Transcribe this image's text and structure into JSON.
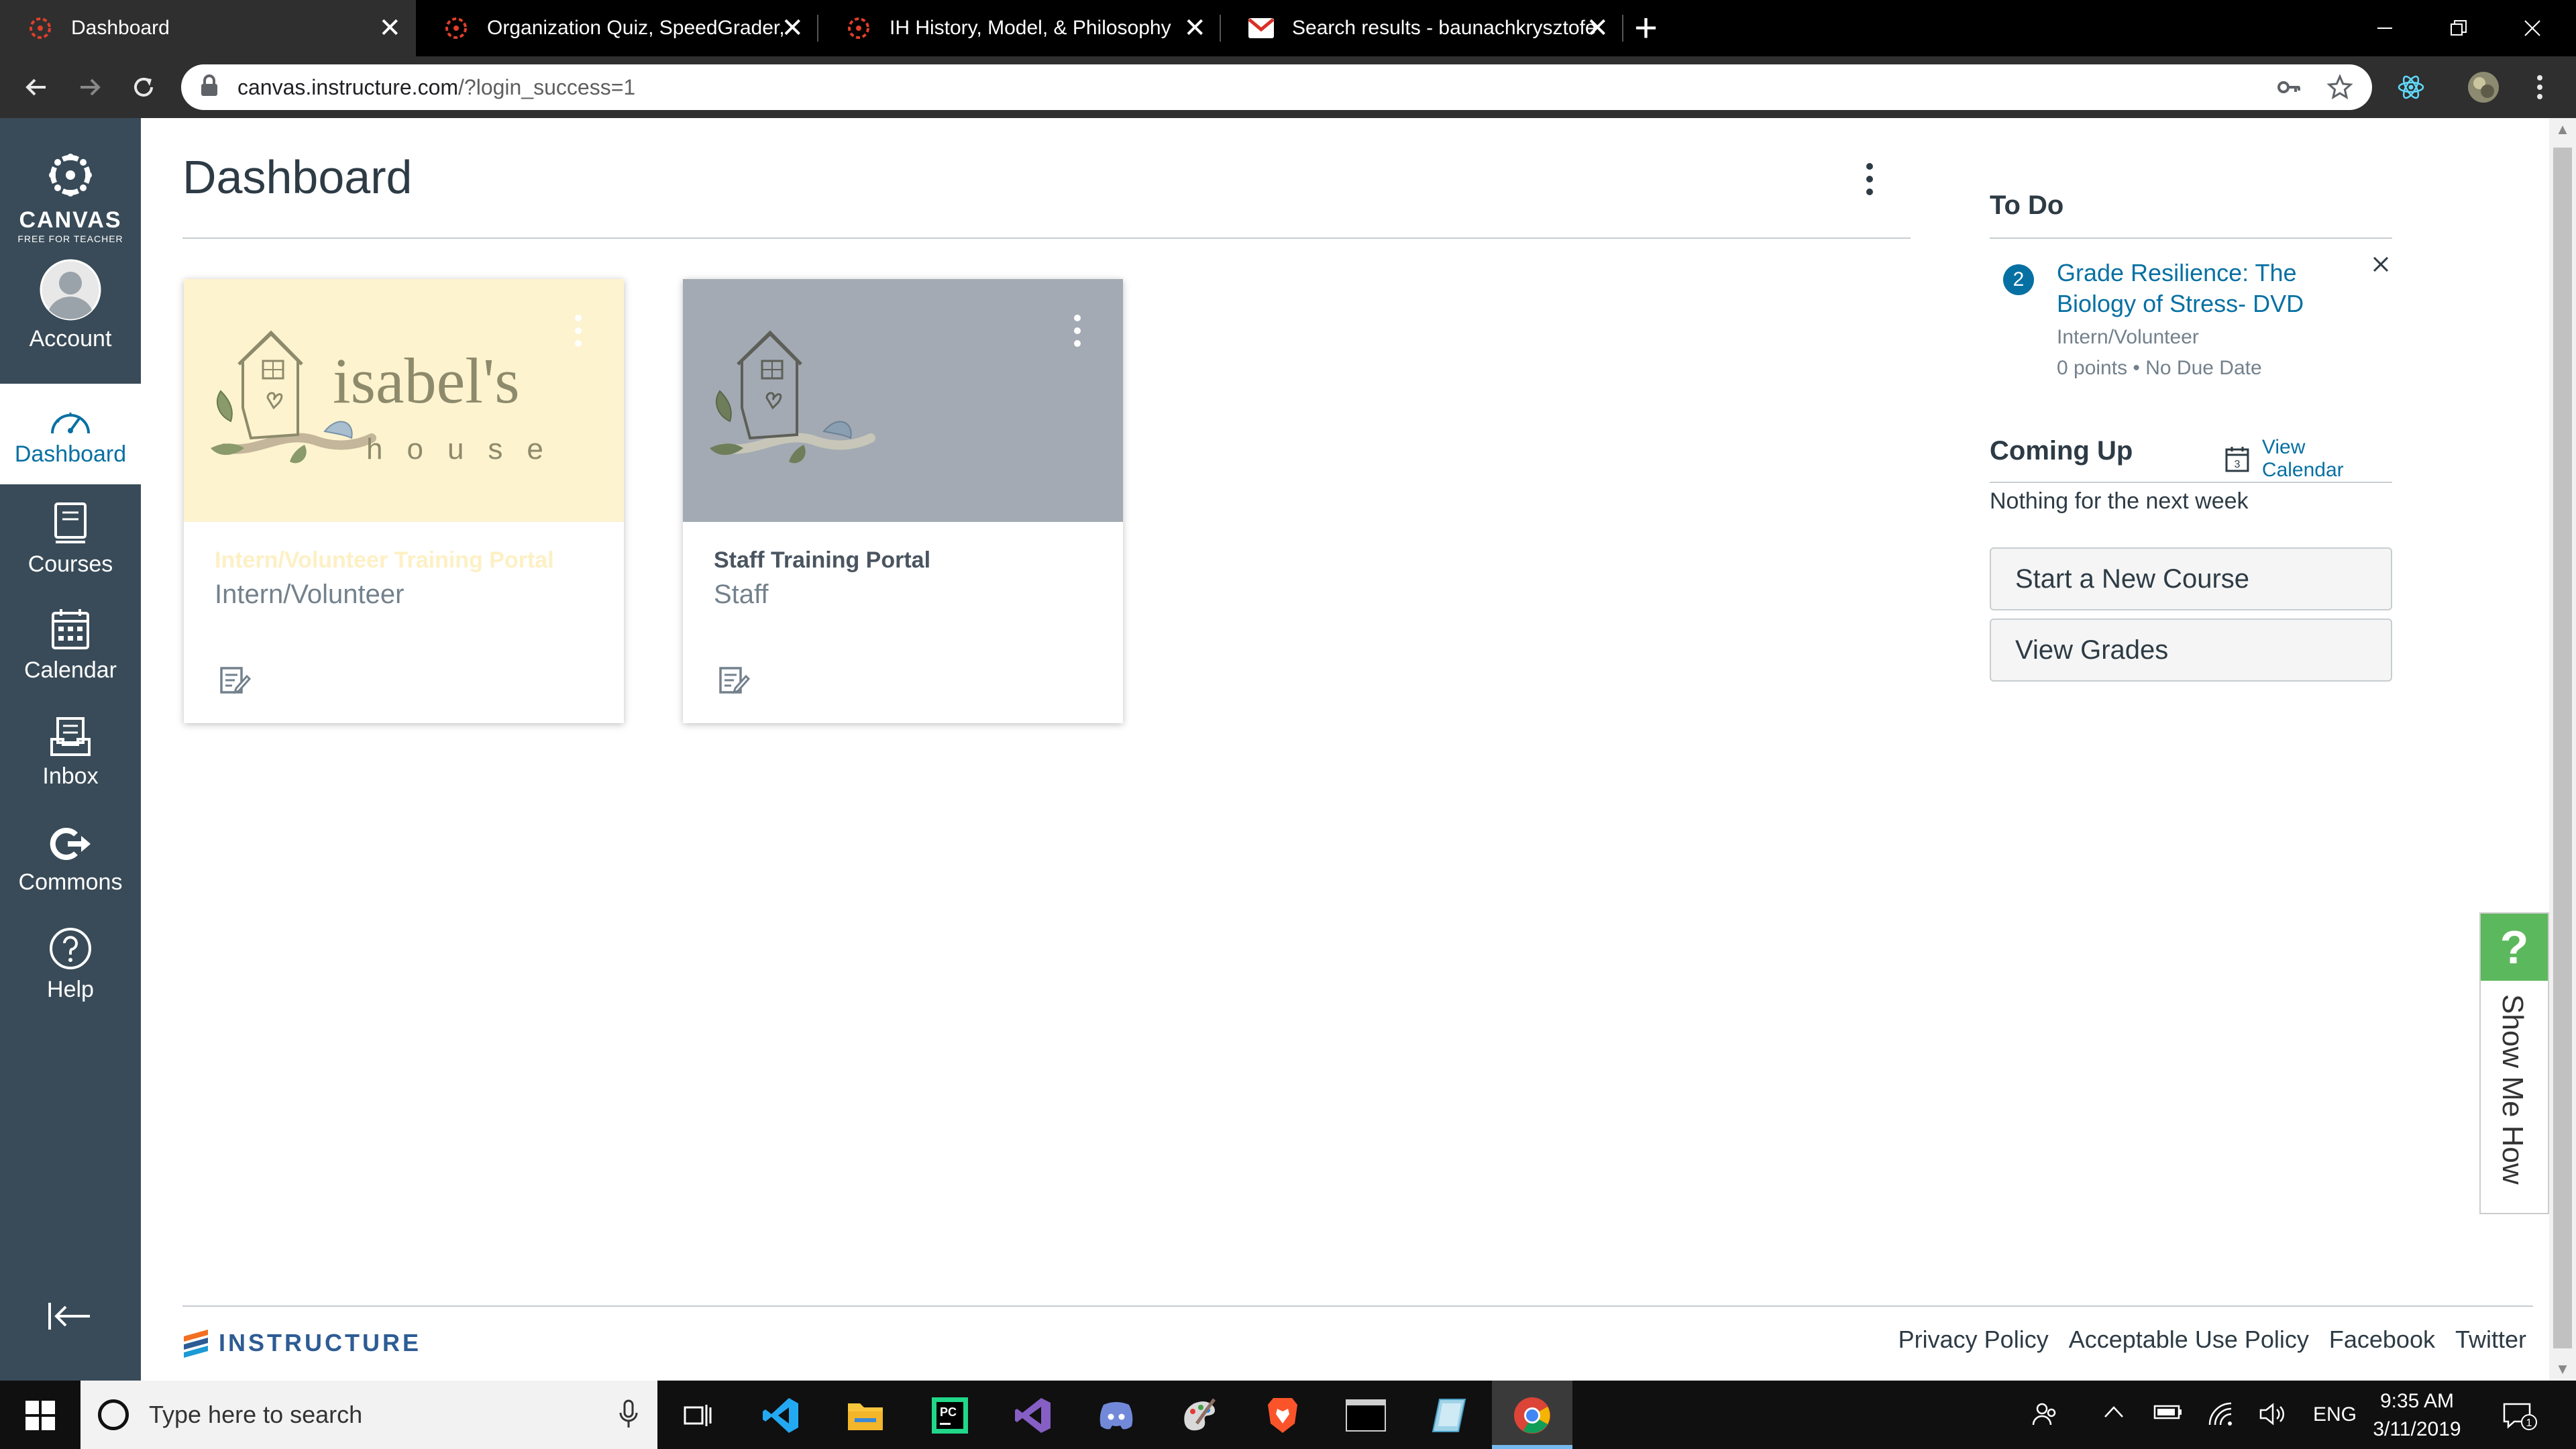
{
  "browser": {
    "tabs": [
      {
        "title": "Dashboard",
        "active": true,
        "icon": "canvas-icon"
      },
      {
        "title": "Organization Quiz, SpeedGrader,",
        "active": false,
        "icon": "canvas-icon"
      },
      {
        "title": "IH History, Model, & Philosophy",
        "active": false,
        "icon": "canvas-icon"
      },
      {
        "title": "Search results - baunachkrysztofe",
        "active": false,
        "icon": "gmail-icon"
      }
    ],
    "close_glyph": "✕",
    "new_tab_glyph": "+",
    "url_host": "canvas.instructure.com",
    "url_path": "/?login_success=1"
  },
  "sidebar": {
    "logo_text": "CANVAS",
    "logo_sub": "FREE FOR TEACHER",
    "items": [
      {
        "label": "Account",
        "icon": "avatar-icon",
        "active": false
      },
      {
        "label": "Dashboard",
        "icon": "dashboard-icon",
        "active": true
      },
      {
        "label": "Courses",
        "icon": "courses-icon",
        "active": false
      },
      {
        "label": "Calendar",
        "icon": "calendar-icon",
        "active": false
      },
      {
        "label": "Inbox",
        "icon": "inbox-icon",
        "active": false
      },
      {
        "label": "Commons",
        "icon": "commons-icon",
        "active": false
      },
      {
        "label": "Help",
        "icon": "help-icon",
        "active": false
      }
    ]
  },
  "main": {
    "title": "Dashboard",
    "cards": [
      {
        "name": "Intern/Volunteer Training Portal",
        "term": "Intern/Volunteer",
        "hero_color": "#fdf3cf",
        "name_color": "#fdf0c4",
        "logo_word": "isabel's",
        "logo_sub": "house"
      },
      {
        "name": "Staff Training Portal",
        "term": "Staff",
        "hero_color": "#a3aab3",
        "name_color": "#4a5560",
        "logo_word": "isabel's",
        "logo_sub": "house"
      }
    ]
  },
  "right": {
    "todo_title": "To Do",
    "todo_badge": "2",
    "todo_item": "Grade Resilience: The Biology of Stress- DVD",
    "todo_course": "Intern/Volunteer",
    "todo_meta": "0 points • No Due Date",
    "coming_title": "Coming Up",
    "view_calendar": "View Calendar",
    "calendar_day": "3",
    "nothing": "Nothing for the next week",
    "btn_new_course": "Start a New Course",
    "btn_view_grades": "View Grades"
  },
  "footer": {
    "logo_text": "INSTRUCTURE",
    "links": [
      "Privacy Policy",
      "Acceptable Use Policy",
      "Facebook",
      "Twitter"
    ]
  },
  "show_me_how": {
    "q": "?",
    "label": "Show Me How"
  },
  "taskbar": {
    "search_placeholder": "Type here to search",
    "lang": "ENG",
    "time": "9:35 AM",
    "date": "3/11/2019",
    "notif_count": "1"
  },
  "colors": {
    "canvas_nav": "#394b58",
    "link": "#0770a3",
    "smh_green": "#5cb85c"
  }
}
